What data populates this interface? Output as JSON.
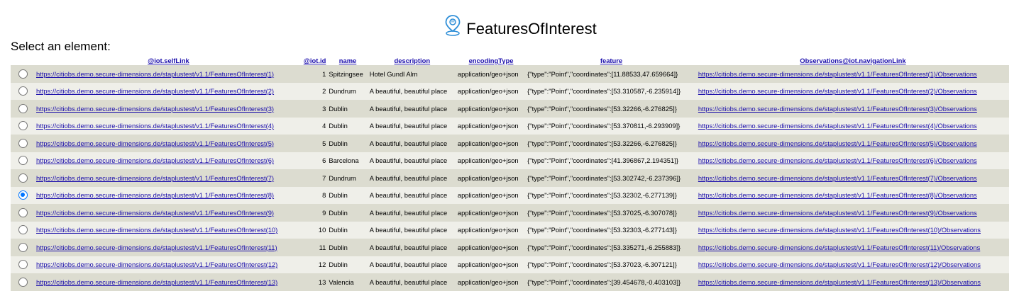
{
  "header": {
    "title": "FeaturesOfInterest",
    "icon": "location-pin-icon",
    "icon_color": "#2f8fd8"
  },
  "prompt": "Select an element:",
  "table": {
    "columns": [
      "@iot.selfLink",
      "@iot.id",
      "name",
      "description",
      "encodingType",
      "feature",
      "Observations@iot.navigationLink"
    ],
    "rows": [
      {
        "selected": false,
        "selfLink": "https://citiobs.demo.secure-dimensions.de/staplustest/v1.1/FeaturesOfInterest(1)",
        "id": "1",
        "name": "Spitzingsee",
        "description": "Hotel Gundl Alm",
        "encodingType": "application/geo+json",
        "feature": "{\"type\":\"Point\",\"coordinates\":[11.88533,47.659664]}",
        "observations": "https://citiobs.demo.secure-dimensions.de/staplustest/v1.1/FeaturesOfInterest(1)/Observations"
      },
      {
        "selected": false,
        "selfLink": "https://citiobs.demo.secure-dimensions.de/staplustest/v1.1/FeaturesOfInterest(2)",
        "id": "2",
        "name": "Dundrum",
        "description": "A beautiful, beautiful place",
        "encodingType": "application/geo+json",
        "feature": "{\"type\":\"Point\",\"coordinates\":[53.310587,-6.235914]}",
        "observations": "https://citiobs.demo.secure-dimensions.de/staplustest/v1.1/FeaturesOfInterest(2)/Observations"
      },
      {
        "selected": false,
        "selfLink": "https://citiobs.demo.secure-dimensions.de/staplustest/v1.1/FeaturesOfInterest(3)",
        "id": "3",
        "name": "Dublin",
        "description": "A beautiful, beautiful place",
        "encodingType": "application/geo+json",
        "feature": "{\"type\":\"Point\",\"coordinates\":[53.32266,-6.276825]}",
        "observations": "https://citiobs.demo.secure-dimensions.de/staplustest/v1.1/FeaturesOfInterest(3)/Observations"
      },
      {
        "selected": false,
        "selfLink": "https://citiobs.demo.secure-dimensions.de/staplustest/v1.1/FeaturesOfInterest(4)",
        "id": "4",
        "name": "Dublin",
        "description": "A beautiful, beautiful place",
        "encodingType": "application/geo+json",
        "feature": "{\"type\":\"Point\",\"coordinates\":[53.370811,-6.293909]}",
        "observations": "https://citiobs.demo.secure-dimensions.de/staplustest/v1.1/FeaturesOfInterest(4)/Observations"
      },
      {
        "selected": false,
        "selfLink": "https://citiobs.demo.secure-dimensions.de/staplustest/v1.1/FeaturesOfInterest(5)",
        "id": "5",
        "name": "Dublin",
        "description": "A beautiful, beautiful place",
        "encodingType": "application/geo+json",
        "feature": "{\"type\":\"Point\",\"coordinates\":[53.32266,-6.276825]}",
        "observations": "https://citiobs.demo.secure-dimensions.de/staplustest/v1.1/FeaturesOfInterest(5)/Observations"
      },
      {
        "selected": false,
        "selfLink": "https://citiobs.demo.secure-dimensions.de/staplustest/v1.1/FeaturesOfInterest(6)",
        "id": "6",
        "name": "Barcelona",
        "description": "A beautiful, beautiful place",
        "encodingType": "application/geo+json",
        "feature": "{\"type\":\"Point\",\"coordinates\":[41.396867,2.194351]}",
        "observations": "https://citiobs.demo.secure-dimensions.de/staplustest/v1.1/FeaturesOfInterest(6)/Observations"
      },
      {
        "selected": false,
        "selfLink": "https://citiobs.demo.secure-dimensions.de/staplustest/v1.1/FeaturesOfInterest(7)",
        "id": "7",
        "name": "Dundrum",
        "description": "A beautiful, beautiful place",
        "encodingType": "application/geo+json",
        "feature": "{\"type\":\"Point\",\"coordinates\":[53.302742,-6.237396]}",
        "observations": "https://citiobs.demo.secure-dimensions.de/staplustest/v1.1/FeaturesOfInterest(7)/Observations"
      },
      {
        "selected": true,
        "selfLink": "https://citiobs.demo.secure-dimensions.de/staplustest/v1.1/FeaturesOfInterest(8)",
        "id": "8",
        "name": "Dublin",
        "description": "A beautiful, beautiful place",
        "encodingType": "application/geo+json",
        "feature": "{\"type\":\"Point\",\"coordinates\":[53.32302,-6.277139]}",
        "observations": "https://citiobs.demo.secure-dimensions.de/staplustest/v1.1/FeaturesOfInterest(8)/Observations"
      },
      {
        "selected": false,
        "selfLink": "https://citiobs.demo.secure-dimensions.de/staplustest/v1.1/FeaturesOfInterest(9)",
        "id": "9",
        "name": "Dublin",
        "description": "A beautiful, beautiful place",
        "encodingType": "application/geo+json",
        "feature": "{\"type\":\"Point\",\"coordinates\":[53.37025,-6.307078]}",
        "observations": "https://citiobs.demo.secure-dimensions.de/staplustest/v1.1/FeaturesOfInterest(9)/Observations"
      },
      {
        "selected": false,
        "selfLink": "https://citiobs.demo.secure-dimensions.de/staplustest/v1.1/FeaturesOfInterest(10)",
        "id": "10",
        "name": "Dublin",
        "description": "A beautiful, beautiful place",
        "encodingType": "application/geo+json",
        "feature": "{\"type\":\"Point\",\"coordinates\":[53.32303,-6.277143]}",
        "observations": "https://citiobs.demo.secure-dimensions.de/staplustest/v1.1/FeaturesOfInterest(10)/Observations"
      },
      {
        "selected": false,
        "selfLink": "https://citiobs.demo.secure-dimensions.de/staplustest/v1.1/FeaturesOfInterest(11)",
        "id": "11",
        "name": "Dublin",
        "description": "A beautiful, beautiful place",
        "encodingType": "application/geo+json",
        "feature": "{\"type\":\"Point\",\"coordinates\":[53.335271,-6.255883]}",
        "observations": "https://citiobs.demo.secure-dimensions.de/staplustest/v1.1/FeaturesOfInterest(11)/Observations"
      },
      {
        "selected": false,
        "selfLink": "https://citiobs.demo.secure-dimensions.de/staplustest/v1.1/FeaturesOfInterest(12)",
        "id": "12",
        "name": "Dublin",
        "description": "A beautiful, beautiful place",
        "encodingType": "application/geo+json",
        "feature": "{\"type\":\"Point\",\"coordinates\":[53.37023,-6.307121]}",
        "observations": "https://citiobs.demo.secure-dimensions.de/staplustest/v1.1/FeaturesOfInterest(12)/Observations"
      },
      {
        "selected": false,
        "selfLink": "https://citiobs.demo.secure-dimensions.de/staplustest/v1.1/FeaturesOfInterest(13)",
        "id": "13",
        "name": "Valencia",
        "description": "A beautiful, beautiful place",
        "encodingType": "application/geo+json",
        "feature": "{\"type\":\"Point\",\"coordinates\":[39.454678,-0.403103]}",
        "observations": "https://citiobs.demo.secure-dimensions.de/staplustest/v1.1/FeaturesOfInterest(13)/Observations"
      }
    ]
  },
  "colors": {
    "link": "#1a0dab",
    "row_odd": "#dcdcd0",
    "row_even": "#efefe9",
    "radio_checked": "#0075ff"
  }
}
